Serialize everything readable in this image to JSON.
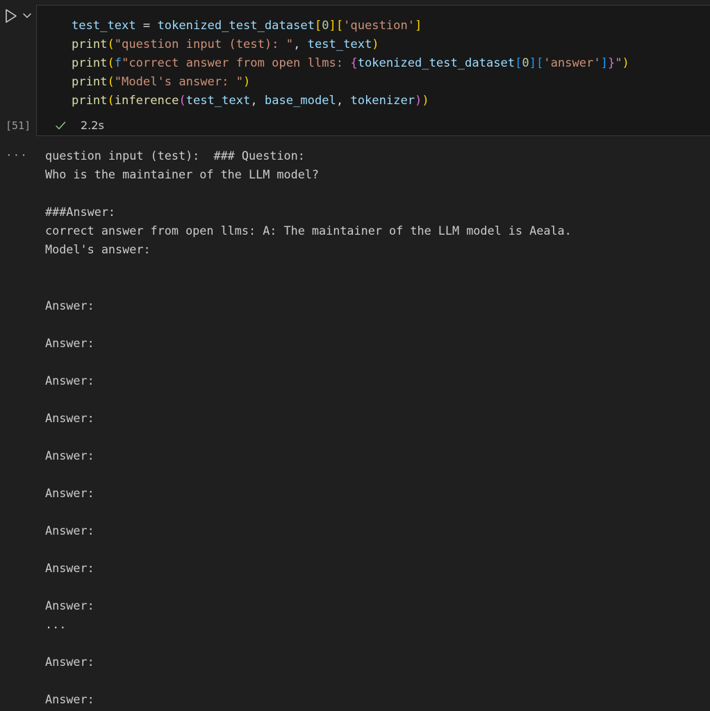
{
  "cell": {
    "exec_count": "[51]",
    "duration": "2.2s",
    "code_lines": [
      [
        {
          "t": "test_text",
          "c": "c-var"
        },
        {
          "t": " = ",
          "c": "c-op"
        },
        {
          "t": "tokenized_test_dataset",
          "c": "c-var"
        },
        {
          "t": "[",
          "c": "b1"
        },
        {
          "t": "0",
          "c": "c-num"
        },
        {
          "t": "]",
          "c": "b1"
        },
        {
          "t": "[",
          "c": "b1"
        },
        {
          "t": "'question'",
          "c": "c-str"
        },
        {
          "t": "]",
          "c": "b1"
        }
      ],
      [
        {
          "t": "print",
          "c": "c-fn"
        },
        {
          "t": "(",
          "c": "b1"
        },
        {
          "t": "\"question input (test): \"",
          "c": "c-str"
        },
        {
          "t": ", ",
          "c": "c-op"
        },
        {
          "t": "test_text",
          "c": "c-var"
        },
        {
          "t": ")",
          "c": "b1"
        }
      ],
      [
        {
          "t": "print",
          "c": "c-fn"
        },
        {
          "t": "(",
          "c": "b1"
        },
        {
          "t": "f",
          "c": "c-kw"
        },
        {
          "t": "\"correct answer from open llms: ",
          "c": "c-str"
        },
        {
          "t": "{",
          "c": "b2"
        },
        {
          "t": "tokenized_test_dataset",
          "c": "c-var"
        },
        {
          "t": "[",
          "c": "b3"
        },
        {
          "t": "0",
          "c": "c-num"
        },
        {
          "t": "]",
          "c": "b3"
        },
        {
          "t": "[",
          "c": "b3"
        },
        {
          "t": "'answer'",
          "c": "c-str"
        },
        {
          "t": "]",
          "c": "b3"
        },
        {
          "t": "}",
          "c": "b2"
        },
        {
          "t": "\"",
          "c": "c-str"
        },
        {
          "t": ")",
          "c": "b1"
        }
      ],
      [
        {
          "t": "print",
          "c": "c-fn"
        },
        {
          "t": "(",
          "c": "b1"
        },
        {
          "t": "\"Model's answer: \"",
          "c": "c-str"
        },
        {
          "t": ")",
          "c": "b1"
        }
      ],
      [
        {
          "t": "print",
          "c": "c-fn"
        },
        {
          "t": "(",
          "c": "b1"
        },
        {
          "t": "inference",
          "c": "c-fn"
        },
        {
          "t": "(",
          "c": "b2"
        },
        {
          "t": "test_text",
          "c": "c-var"
        },
        {
          "t": ", ",
          "c": "c-op"
        },
        {
          "t": "base_model",
          "c": "c-var"
        },
        {
          "t": ", ",
          "c": "c-op"
        },
        {
          "t": "tokenizer",
          "c": "c-var"
        },
        {
          "t": ")",
          "c": "b2"
        },
        {
          "t": ")",
          "c": "b1"
        }
      ]
    ]
  },
  "output": {
    "more_glyph": "···",
    "lines": [
      "question input (test):  ### Question:",
      "Who is the maintainer of the LLM model?",
      "",
      "###Answer:",
      "correct answer from open llms: A: The maintainer of the LLM model is Aeala.",
      "Model's answer:",
      "",
      "",
      "Answer:",
      "",
      "Answer:",
      "",
      "Answer:",
      "",
      "Answer:",
      "",
      "Answer:",
      "",
      "Answer:",
      "",
      "Answer:",
      "",
      "Answer:",
      "",
      "Answer:",
      "...",
      "",
      "Answer:",
      "",
      "Answer:"
    ]
  },
  "colors": {
    "background": "#1f1f1f",
    "editor_bg": "#181818",
    "variable": "#9cdcfe",
    "function": "#dcdcaa",
    "string": "#ce9178",
    "bracket_level1": "#ffd700",
    "bracket_level2": "#da70d6",
    "bracket_level3": "#179fff",
    "success_check": "#89d185"
  },
  "icons": {
    "run": "play-icon",
    "run_dropdown": "chevron-down-icon",
    "status": "check-icon"
  }
}
